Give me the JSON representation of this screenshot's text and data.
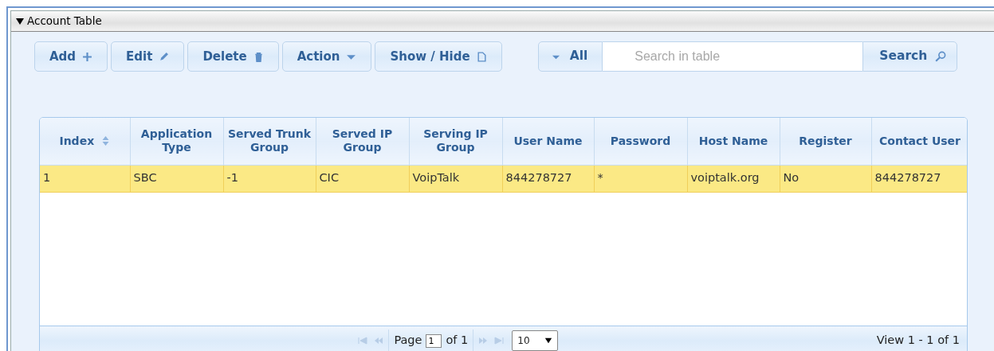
{
  "panel": {
    "title": "Account Table",
    "expanded": true
  },
  "toolbar": [
    {
      "label": "Add",
      "kind": "add"
    },
    {
      "label": "Edit",
      "kind": "edit"
    },
    {
      "label": "Delete",
      "kind": "delete"
    },
    {
      "label": "Action",
      "kind": "dropdown"
    },
    {
      "label": "Show / Hide",
      "kind": "columns"
    }
  ],
  "search": {
    "filter": "All",
    "placeholder": "Search in table",
    "button": "Search"
  },
  "table": {
    "columns": [
      {
        "label": "Index",
        "sorted": true
      },
      {
        "label": "Application Type",
        "sorted": false
      },
      {
        "label": "Served Trunk Group",
        "sorted": false
      },
      {
        "label": "Served IP Group",
        "sorted": false
      },
      {
        "label": "Serving IP Group",
        "sorted": false
      },
      {
        "label": "User Name",
        "sorted": false
      },
      {
        "label": "Password",
        "sorted": false
      },
      {
        "label": "Host Name",
        "sorted": false
      },
      {
        "label": "Register",
        "sorted": false
      },
      {
        "label": "Contact User",
        "sorted": false
      }
    ],
    "rows": [
      {
        "selected": true,
        "cells": [
          "1",
          "SBC",
          "-1",
          "CIC",
          "VoipTalk",
          "844278727",
          "*",
          "voiptalk.org",
          "No",
          "844278727"
        ]
      }
    ]
  },
  "pager": {
    "page_label": "Page",
    "page": "1",
    "of": "of 1",
    "page_size": "10",
    "view": "View 1 - 1 of 1"
  }
}
